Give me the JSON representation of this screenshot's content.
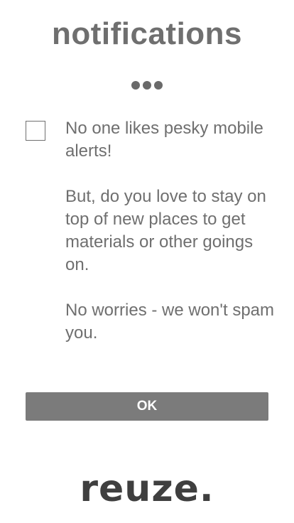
{
  "header": {
    "title": "notifications"
  },
  "pager": {
    "dots": 3
  },
  "notification": {
    "checkbox_checked": false,
    "paragraphs": [
      "No one likes pesky mobile alerts!",
      "But, do you love to stay on top of new places to get materials or other goings on.",
      "No worries - we won't spam you."
    ]
  },
  "actions": {
    "ok_label": "OK"
  },
  "footer": {
    "logo_text": "reuze."
  },
  "colors": {
    "text": "#6f6f6f",
    "button": "#7b7b7b",
    "logo": "#3f3f3f"
  }
}
